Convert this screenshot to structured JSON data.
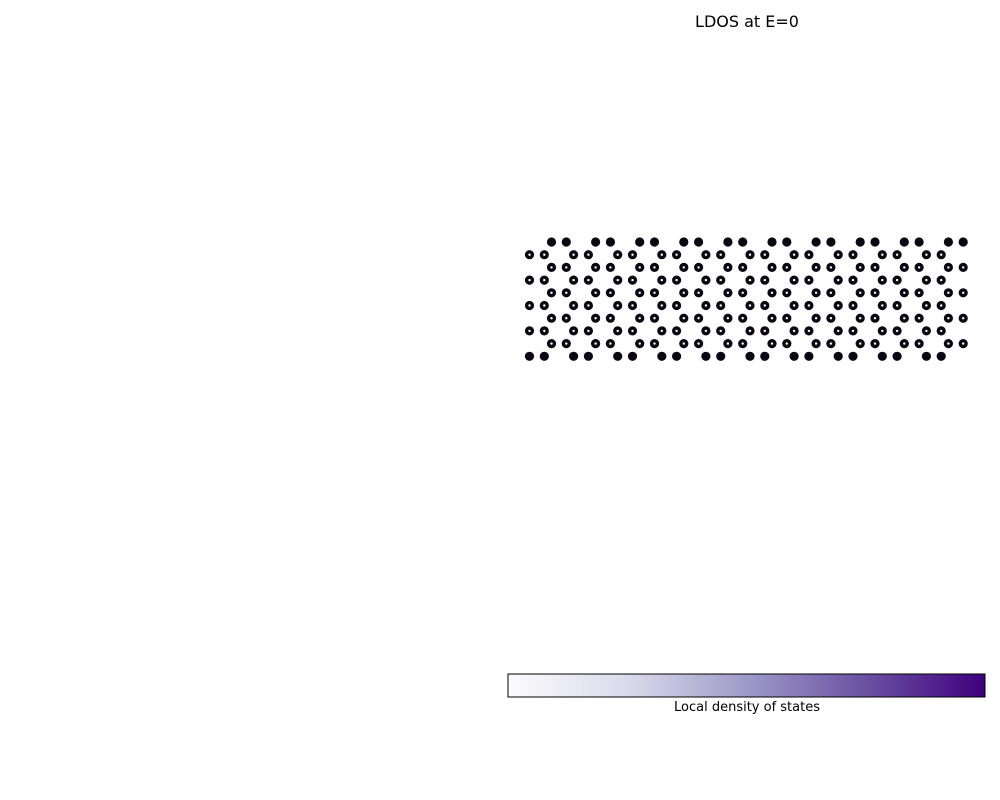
{
  "chart_data": {
    "type": "scatter",
    "title": "LDOS at E=0",
    "colorbar": {
      "label": "Local density of states",
      "colormap": "Purples",
      "colors": [
        "#fcfbfd",
        "#dadaeb",
        "#9e9ac8",
        "#6a51a3",
        "#3f007d"
      ]
    },
    "lattice": {
      "kind": "honeycomb",
      "rows": 10,
      "columns": 11,
      "site_fill": "#0a0612",
      "center_fill": "#ffffff",
      "edge_rows_value": "high",
      "interior_rows_value": "low"
    }
  }
}
